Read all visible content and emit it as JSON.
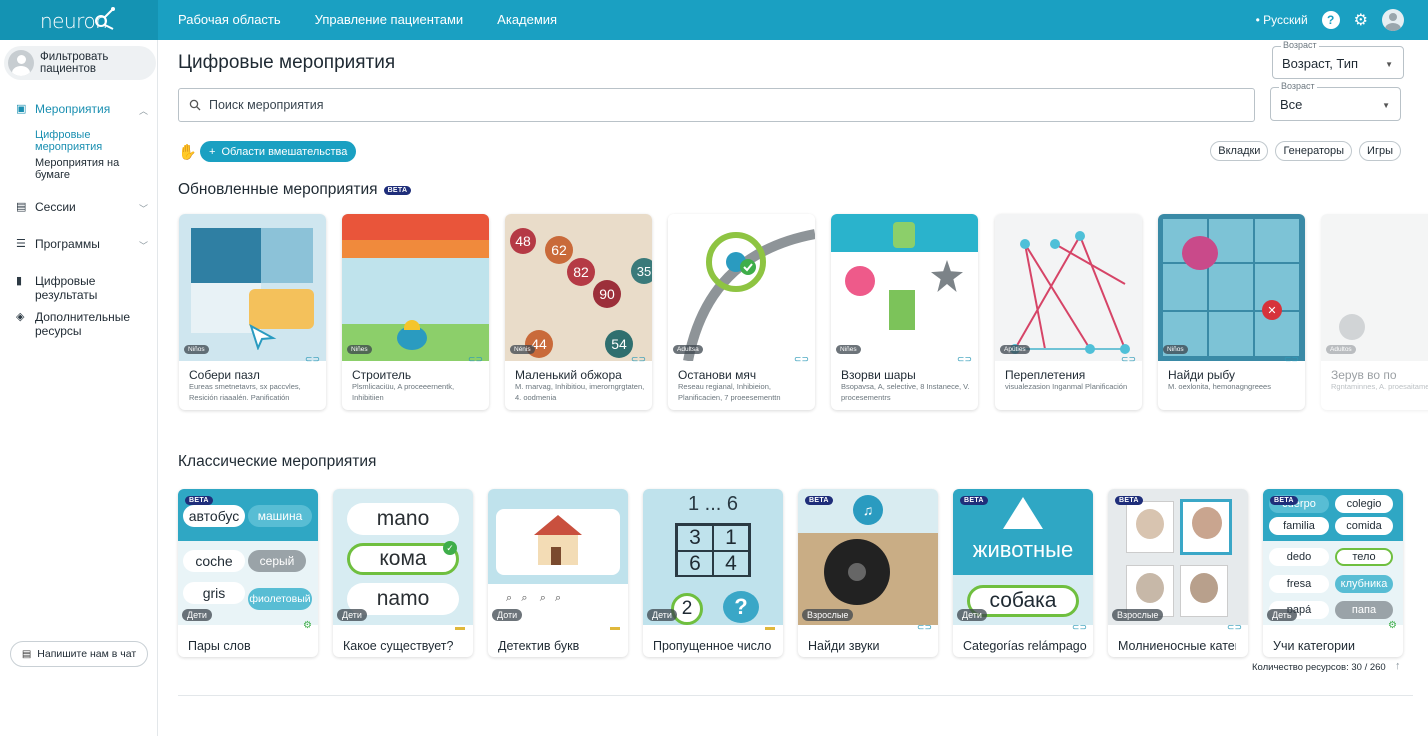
{
  "topbar": {
    "logo": "neuron",
    "nav": [
      "Рабочая область",
      "Управление пациентами",
      "Академия"
    ],
    "language": "Русский",
    "accent": "#1aa0c2"
  },
  "sidebar": {
    "filter_label": "Фильтровать пациентов",
    "items": [
      {
        "label": "Мероприятия",
        "icon": "calendar-icon"
      },
      {
        "label": "Сессии",
        "icon": "calendar-icon"
      },
      {
        "label": "Программы",
        "icon": "list-icon"
      },
      {
        "label": "Цифровые результаты",
        "icon": "bar-chart-icon"
      },
      {
        "label": "Дополнительные ресурсы",
        "icon": "cube-icon"
      }
    ],
    "sub_items": [
      "Цифровые мероприятия",
      "Мероприятия на бумаге"
    ],
    "chat_label": "Напишите нам в чат"
  },
  "main": {
    "title": "Цифровые мероприятия",
    "sort_select": {
      "label": "Возраст",
      "value": "Возраст, Тип"
    },
    "age_select": {
      "label": "Возраст",
      "value": "Все"
    },
    "search_placeholder": "Поиск мероприятия",
    "areas_button": "Области вмешательства",
    "chips": [
      "Вкладки",
      "Генераторы",
      "Игры"
    ],
    "updated_section": {
      "title": "Обновленные мероприятия",
      "beta": "BETA",
      "cards": [
        {
          "title": "Собери пазл",
          "age": "Niños",
          "desc": "Eureas smetnetavrs, sx paccvles, Resición riaaalén. Panificatión"
        },
        {
          "title": "Строитель",
          "age": "Niñes",
          "desc": "Plsmlicaciüu, A proceeernentk, Inhibitiien"
        },
        {
          "title": "Маленький обжора",
          "age": "Nénis",
          "desc": "M. rnarvag, Inhibitiou, imerorngrgtaten, 4. oodmenia"
        },
        {
          "title": "Останови мяч",
          "age": "Adultsa",
          "desc": "Reseau regianal, Inhibieion, Planificacien, 7 proeesementtn"
        },
        {
          "title": "Взорви шары",
          "age": "Niñes",
          "desc": "Bsopavsa, A, selective, 8 Instanece, V. procesementrs"
        },
        {
          "title": "Переплетения",
          "age": "Apüties",
          "desc": "visualezasion Inganmal Planificación"
        },
        {
          "title": "Найди рыбу",
          "age": "Niños",
          "desc": "M. oexlonita, hemonagngreees"
        },
        {
          "title": "Зерув во по",
          "age": "Adultos",
          "desc": "Rgntaminnes, A. proesaitamenn"
        }
      ]
    },
    "classic_section": {
      "title": "Классические мероприятия",
      "cards": [
        {
          "title": "Пары слов",
          "age": "Дети",
          "beta": true
        },
        {
          "title": "Какое существует?",
          "age": "Дети",
          "beta": false
        },
        {
          "title": "Детектив букв",
          "age": "Доти",
          "beta": false
        },
        {
          "title": "Пропущенное число",
          "age": "Дети",
          "beta": false
        },
        {
          "title": "Найди звуки",
          "age": "Взрослые",
          "beta": true
        },
        {
          "title": "Categorías relámpago",
          "age": "Дети",
          "beta": true
        },
        {
          "title": "Молниеносные категории",
          "age": "Взрослые",
          "beta": true
        },
        {
          "title": "Учи категории",
          "age": "Деть",
          "beta": true
        }
      ],
      "word_pairs": [
        "автобус",
        "машина",
        "coche",
        "серый",
        "gris",
        "фиолетовый"
      ],
      "which_words": [
        "mano",
        "кома",
        "namo"
      ],
      "numbers": {
        "header": "1 ... 6",
        "grid": [
          "3",
          "1",
          "6",
          "4"
        ],
        "answer": "2",
        "missing": "?"
      },
      "category_word": "животные",
      "category_answer": "собака",
      "learn_words": [
        "cuerpo",
        "colegio",
        "familia",
        "comida",
        "dedo",
        "тело",
        "fresa",
        "клубника",
        "papá",
        "папа"
      ]
    },
    "resource_count": "Количество ресурсов: 30 / 260"
  }
}
